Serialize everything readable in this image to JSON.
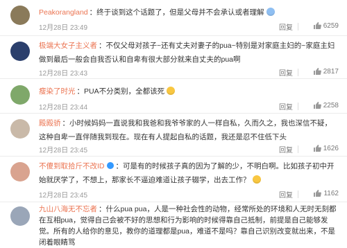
{
  "comments": [
    {
      "user": "Peakorangland",
      "sep": "：",
      "text": "终于谈到这个话题了，但是父母并不会承认或者理解",
      "time": "12月28日 23:49",
      "reply": "回复",
      "likes": "6259",
      "avatar_color": "#8a7a5a"
    },
    {
      "user": "极端大女子主义者",
      "sep": "：",
      "text": "不仅父母对孩子~还有丈夫对妻子的pua~特别是对家庭主妇的~家庭主妇做到最后一般会自我否认和自卑有很大部分就来自丈夫的pua啊",
      "time": "12月28日 23:43",
      "reply": "回复",
      "likes": "2817",
      "avatar_color": "#2b3f6c"
    },
    {
      "user": "瘦染了时光",
      "sep": "：",
      "text": "PUA不分类别，全都该死",
      "time": "12月28日 23:44",
      "reply": "回复",
      "likes": "2258",
      "avatar_color": "#7fa86a"
    },
    {
      "user": "殿殿骄",
      "sep": "：",
      "text": "小时候妈妈一直说我和我爸和我爷爷家的人一样自私，久而久之，我也深信不疑，这种自卑一直伴随我到现在。现在有人提起自私的话题，我还是忍不住低下头",
      "time": "12月28日 23:45",
      "reply": "回复",
      "likes": "1626",
      "avatar_color": "#c9b9a8"
    },
    {
      "user": "不傻到取拾斤不改ID",
      "sep": "：",
      "text": "可是有的时候孩子真的因为了解的少，不明白啊。比如孩子初中开始就厌学了，不想上，那家长不逼迫难道让孩子辍学，出去工作？",
      "time": "12月28日 23:45",
      "reply": "回复",
      "likes": "1162",
      "avatar_color": "#d9a38f"
    },
    {
      "user": "九山八海无不忘者",
      "sep": "：",
      "text": "什么pua pua，人是一种社会性的动物，经常所处的环境和人无时无刻都在互相pua，觉得自己会被不好的思想和行为影响的时候得靠自己抵制，前提是自己能够发觉。所有的人给你的意见，教你的道理都是pua，难道不是吗？靠自己识别改变就出来，不是闭着眼睛骂",
      "time": "",
      "reply": "",
      "likes": "",
      "avatar_color": "#9aa6b8"
    }
  ]
}
